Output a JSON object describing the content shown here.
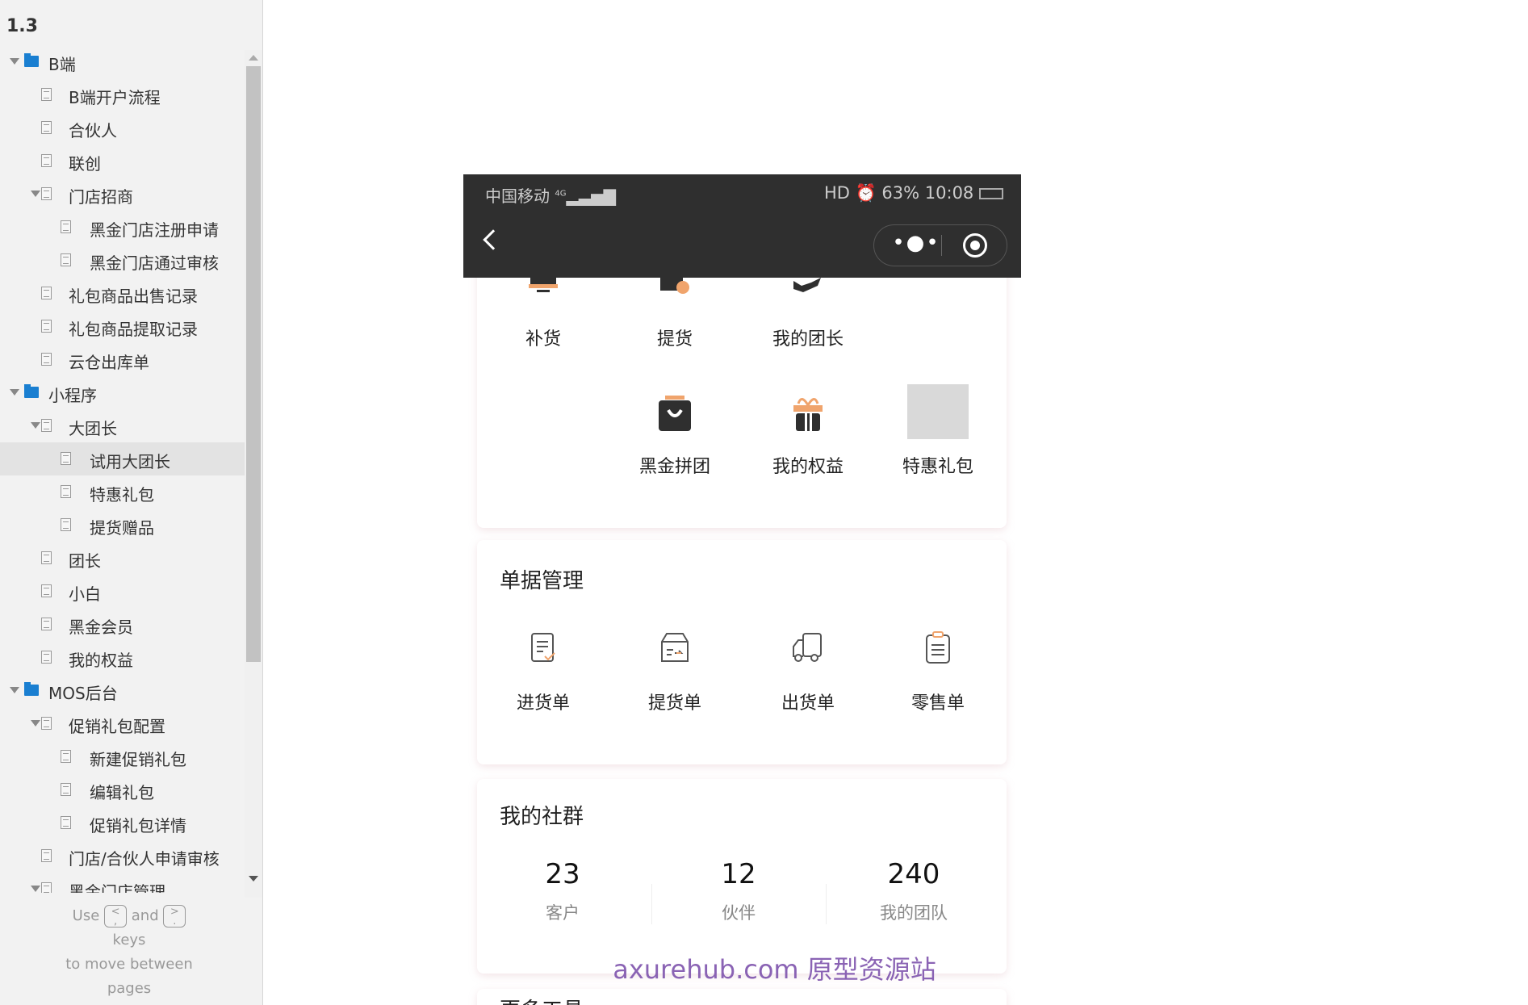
{
  "sidebar": {
    "version": "1.3",
    "tree": [
      {
        "label": "B端",
        "level": 0,
        "type": "folder",
        "expanded": true
      },
      {
        "label": "B端开户流程",
        "level": 1,
        "type": "page"
      },
      {
        "label": "合伙人",
        "level": 1,
        "type": "page"
      },
      {
        "label": "联创",
        "level": 1,
        "type": "page"
      },
      {
        "label": "门店招商",
        "level": 1,
        "type": "page",
        "expanded": true
      },
      {
        "label": "黑金门店注册申请",
        "level": 2,
        "type": "page"
      },
      {
        "label": "黑金门店通过审核",
        "level": 2,
        "type": "page"
      },
      {
        "label": "礼包商品出售记录",
        "level": 1,
        "type": "page"
      },
      {
        "label": "礼包商品提取记录",
        "level": 1,
        "type": "page"
      },
      {
        "label": "云仓出库单",
        "level": 1,
        "type": "page"
      },
      {
        "label": "小程序",
        "level": 0,
        "type": "folder",
        "expanded": true
      },
      {
        "label": "大团长",
        "level": 1,
        "type": "page",
        "expanded": true
      },
      {
        "label": "试用大团长",
        "level": 2,
        "type": "page",
        "selected": true
      },
      {
        "label": "特惠礼包",
        "level": 2,
        "type": "page"
      },
      {
        "label": "提货赠品",
        "level": 2,
        "type": "page"
      },
      {
        "label": "团长",
        "level": 1,
        "type": "page"
      },
      {
        "label": "小白",
        "level": 1,
        "type": "page"
      },
      {
        "label": "黑金会员",
        "level": 1,
        "type": "page"
      },
      {
        "label": "我的权益",
        "level": 1,
        "type": "page"
      },
      {
        "label": "MOS后台",
        "level": 0,
        "type": "folder",
        "expanded": true
      },
      {
        "label": "促销礼包配置",
        "level": 1,
        "type": "page",
        "expanded": true
      },
      {
        "label": "新建促销礼包",
        "level": 2,
        "type": "page"
      },
      {
        "label": "编辑礼包",
        "level": 2,
        "type": "page"
      },
      {
        "label": "促销礼包详情",
        "level": 2,
        "type": "page"
      },
      {
        "label": "门店/合伙人申请审核",
        "level": 1,
        "type": "page"
      },
      {
        "label": "黑金门店管理",
        "level": 1,
        "type": "page",
        "expanded": true
      }
    ],
    "hint": {
      "use": "Use",
      "key_prev": "<\n,",
      "and": "and",
      "key_next": ">\n.",
      "keys": "keys",
      "move": "to move between",
      "pages": "pages"
    }
  },
  "phone": {
    "status": {
      "carrier": "中国移动",
      "network": "4G",
      "right": "HD ⏰ 63% 10:08",
      "battery": "63%",
      "time": "10:08"
    },
    "capsule": {
      "more": "•●•"
    },
    "grid": [
      {
        "label": "补货",
        "icon": "restock-icon"
      },
      {
        "label": "提货",
        "icon": "pickup-icon"
      },
      {
        "label": "我的团长",
        "icon": "my-leader-icon"
      },
      {
        "label": "",
        "icon": ""
      },
      {
        "label": "",
        "icon": ""
      },
      {
        "label": "黑金拼团",
        "icon": "shopping-bag-icon"
      },
      {
        "label": "我的权益",
        "icon": "gift-icon"
      },
      {
        "label": "特惠礼包",
        "icon": "image-placeholder"
      }
    ],
    "orders": {
      "title": "单据管理",
      "items": [
        {
          "label": "进货单",
          "icon": "purchase-order-icon"
        },
        {
          "label": "提货单",
          "icon": "pickup-order-icon"
        },
        {
          "label": "出货单",
          "icon": "truck-icon"
        },
        {
          "label": "零售单",
          "icon": "clipboard-icon"
        }
      ]
    },
    "community": {
      "title": "我的社群",
      "stats": [
        {
          "value": "23",
          "label": "客户"
        },
        {
          "value": "12",
          "label": "伙伴"
        },
        {
          "value": "240",
          "label": "我的团队"
        }
      ]
    },
    "more_title": "更多工具"
  },
  "watermark": "axurehub.com 原型资源站",
  "colors": {
    "accent": "#f0a46c",
    "dark": "#2f2f2f",
    "watermark": "#8a63b4",
    "folder": "#1a7fd1"
  }
}
